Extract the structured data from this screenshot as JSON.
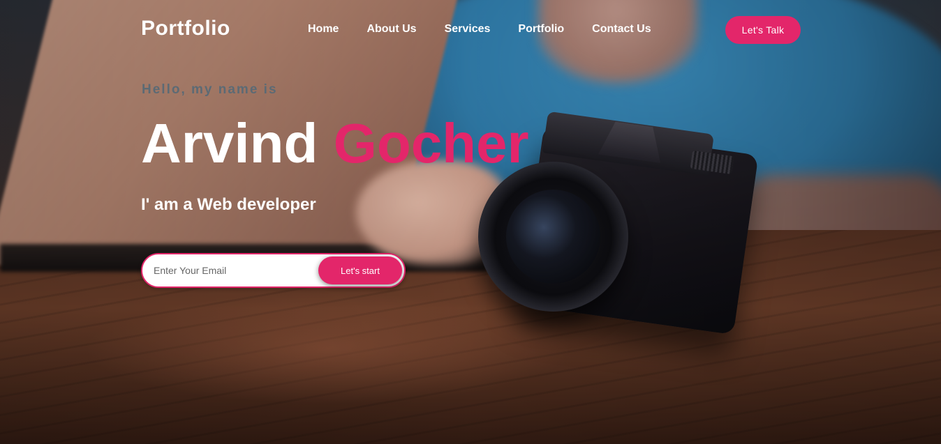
{
  "nav": {
    "logo": "Portfolio",
    "links": [
      {
        "label": "Home"
      },
      {
        "label": "About Us"
      },
      {
        "label": "Services"
      },
      {
        "label": "Portfolio"
      },
      {
        "label": "Contact Us"
      }
    ],
    "cta_label": "Let's Talk"
  },
  "hero": {
    "greeting": "Hello, my name is",
    "first_name": "Arvind",
    "last_name": "Gocher",
    "role": "I' am a Web developer",
    "email_placeholder": "Enter Your Email",
    "email_value": "",
    "submit_label": "Let's start"
  },
  "colors": {
    "accent": "#e3266a",
    "text_light": "#ffffff",
    "greeting_text": "#5c6a74"
  },
  "background_image": "laptop-and-camera-on-wooden-desk"
}
